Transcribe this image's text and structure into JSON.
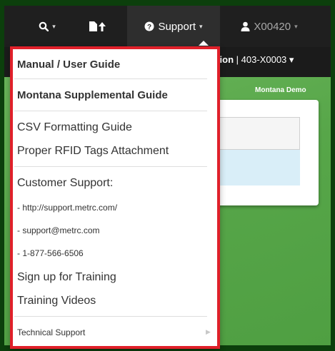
{
  "navbar": {
    "search_caret": "▾",
    "support_label": "Support",
    "support_caret": "▾",
    "user_label": "X00420",
    "user_caret": "▾"
  },
  "facility": {
    "name": "ation",
    "separator": " | ",
    "license": "403-X0003",
    "caret": " ▾"
  },
  "environment_label": "Montana Demo",
  "support_menu": {
    "manual": "Manual / User Guide",
    "supplemental": "Montana Supplemental Guide",
    "csv_guide": "CSV Formatting Guide",
    "rfid_attachment": "Proper RFID Tags Attachment",
    "customer_support_heading": "Customer Support:",
    "support_url": "- http://support.metrc.com/",
    "support_email": "- support@metrc.com",
    "support_phone": "- 1-877-566-6506",
    "training_signup": "Sign up for Training",
    "training_videos": "Training Videos",
    "technical_support": "Technical Support"
  },
  "colors": {
    "navbar": "#1f1f1f",
    "menu_outline": "#e0202a",
    "background_green": "#57a649"
  }
}
